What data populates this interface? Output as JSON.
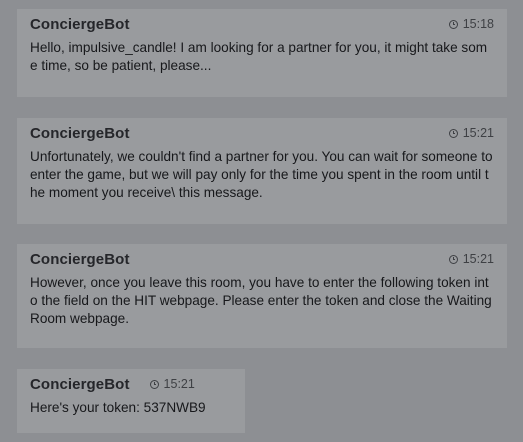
{
  "messages": [
    {
      "sender": "ConciergeBot",
      "time": "15:18",
      "text": "Hello, impulsive_candle! I am looking for a partner for you, it might take some time, so be patient, please..."
    },
    {
      "sender": "ConciergeBot",
      "time": "15:21",
      "text": "Unfortunately, we couldn't find a partner for you. You can wait for someone to enter the game, but we will pay only for the time you spent in the room until the moment you receive\\ this message."
    },
    {
      "sender": "ConciergeBot",
      "time": "15:21",
      "text": "However, once you leave this room, you have to enter the following token into the field on the HIT webpage. Please enter the token and close the Waiting Room webpage."
    },
    {
      "sender": "ConciergeBot",
      "time": "15:21",
      "text": "Here's your token: 537NWB9"
    }
  ]
}
